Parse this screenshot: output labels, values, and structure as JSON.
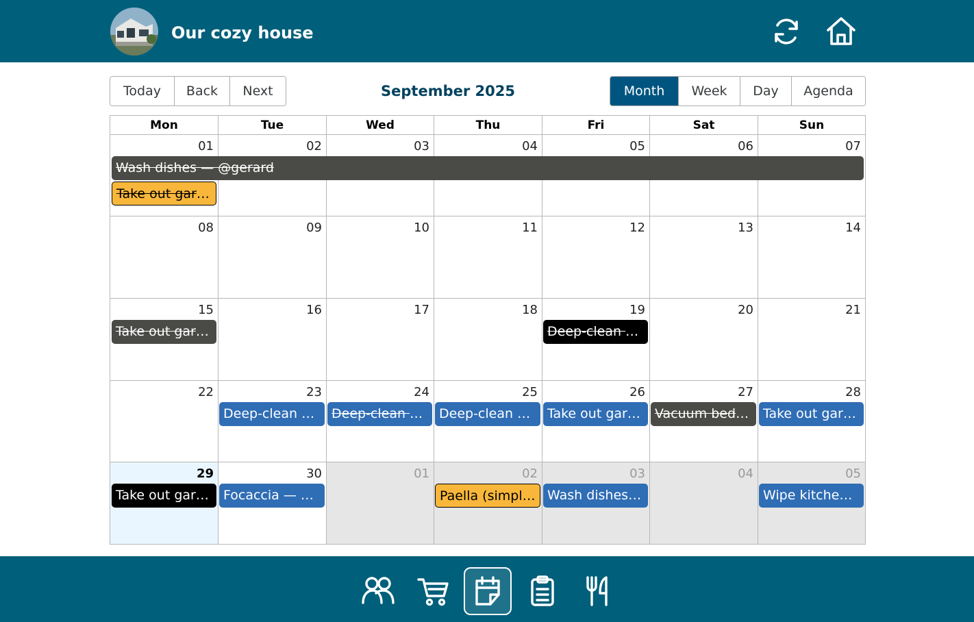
{
  "app": {
    "title": "Our cozy house"
  },
  "toolbar": {
    "nav": [
      "Today",
      "Back",
      "Next"
    ],
    "label": "September 2025",
    "views": [
      "Month",
      "Week",
      "Day",
      "Agenda"
    ],
    "active_view": "Month"
  },
  "calendar": {
    "weekdays": [
      "Mon",
      "Tue",
      "Wed",
      "Thu",
      "Fri",
      "Sat",
      "Sun"
    ],
    "weeks": [
      [
        {
          "day": "01",
          "in_month": true
        },
        {
          "day": "02",
          "in_month": true
        },
        {
          "day": "03",
          "in_month": true
        },
        {
          "day": "04",
          "in_month": true
        },
        {
          "day": "05",
          "in_month": true
        },
        {
          "day": "06",
          "in_month": true
        },
        {
          "day": "07",
          "in_month": true
        }
      ],
      [
        {
          "day": "08",
          "in_month": true
        },
        {
          "day": "09",
          "in_month": true
        },
        {
          "day": "10",
          "in_month": true
        },
        {
          "day": "11",
          "in_month": true
        },
        {
          "day": "12",
          "in_month": true
        },
        {
          "day": "13",
          "in_month": true
        },
        {
          "day": "14",
          "in_month": true
        }
      ],
      [
        {
          "day": "15",
          "in_month": true
        },
        {
          "day": "16",
          "in_month": true
        },
        {
          "day": "17",
          "in_month": true
        },
        {
          "day": "18",
          "in_month": true
        },
        {
          "day": "19",
          "in_month": true
        },
        {
          "day": "20",
          "in_month": true
        },
        {
          "day": "21",
          "in_month": true
        }
      ],
      [
        {
          "day": "22",
          "in_month": true
        },
        {
          "day": "23",
          "in_month": true
        },
        {
          "day": "24",
          "in_month": true
        },
        {
          "day": "25",
          "in_month": true
        },
        {
          "day": "26",
          "in_month": true
        },
        {
          "day": "27",
          "in_month": true
        },
        {
          "day": "28",
          "in_month": true
        }
      ],
      [
        {
          "day": "29",
          "in_month": true,
          "today": true
        },
        {
          "day": "30",
          "in_month": true
        },
        {
          "day": "01",
          "in_month": false
        },
        {
          "day": "02",
          "in_month": false
        },
        {
          "day": "03",
          "in_month": false
        },
        {
          "day": "04",
          "in_month": false
        },
        {
          "day": "05",
          "in_month": false
        }
      ]
    ],
    "events": [
      {
        "week": 0,
        "col": 0,
        "span": 7,
        "slot": 0,
        "title": "Wash dishes — @gerard",
        "done": true,
        "bg": "#4a4a47",
        "color": "#ffffff"
      },
      {
        "week": 0,
        "col": 0,
        "span": 1,
        "slot": 1,
        "title": "Take out garb...",
        "done": true,
        "bg": "#f8b73b",
        "color": "#000000",
        "border": "#000000"
      },
      {
        "week": 2,
        "col": 0,
        "span": 1,
        "slot": 0,
        "title": "Take out garb...",
        "done": true,
        "bg": "#4a4a47",
        "color": "#ffffff"
      },
      {
        "week": 2,
        "col": 4,
        "span": 1,
        "slot": 0,
        "title": "Deep-clean b...",
        "done": true,
        "bg": "#000000",
        "color": "#ffffff"
      },
      {
        "week": 3,
        "col": 1,
        "span": 1,
        "slot": 0,
        "title": "Deep-clean b...",
        "done": false,
        "bg": "#2f6db5",
        "color": "#ffffff"
      },
      {
        "week": 3,
        "col": 2,
        "span": 1,
        "slot": 0,
        "title": "Deep-clean b...",
        "done": true,
        "bg": "#2f6db5",
        "color": "#ffffff"
      },
      {
        "week": 3,
        "col": 3,
        "span": 1,
        "slot": 0,
        "title": "Deep-clean b...",
        "done": false,
        "bg": "#2f6db5",
        "color": "#ffffff"
      },
      {
        "week": 3,
        "col": 4,
        "span": 1,
        "slot": 0,
        "title": "Take out garb...",
        "done": false,
        "bg": "#2f6db5",
        "color": "#ffffff"
      },
      {
        "week": 3,
        "col": 5,
        "span": 1,
        "slot": 0,
        "title": "Vacuum bedr...",
        "done": true,
        "bg": "#4a4a47",
        "color": "#ffffff"
      },
      {
        "week": 3,
        "col": 6,
        "span": 1,
        "slot": 0,
        "title": "Take out garb...",
        "done": false,
        "bg": "#2f6db5",
        "color": "#ffffff"
      },
      {
        "week": 4,
        "col": 0,
        "span": 1,
        "slot": 0,
        "title": "Take out garb...",
        "done": false,
        "bg": "#000000",
        "color": "#ffffff"
      },
      {
        "week": 4,
        "col": 1,
        "span": 1,
        "slot": 0,
        "title": "Focaccia — @...",
        "done": false,
        "bg": "#2f6db5",
        "color": "#ffffff"
      },
      {
        "week": 4,
        "col": 3,
        "span": 1,
        "slot": 0,
        "title": "Paella (simple...",
        "done": false,
        "bg": "#f8b73b",
        "color": "#000000",
        "border": "#000000"
      },
      {
        "week": 4,
        "col": 4,
        "span": 1,
        "slot": 0,
        "title": "Wash dishes ...",
        "done": false,
        "bg": "#2f6db5",
        "color": "#ffffff"
      },
      {
        "week": 4,
        "col": 6,
        "span": 1,
        "slot": 0,
        "title": "Wipe kitchen ...",
        "done": false,
        "bg": "#2f6db5",
        "color": "#ffffff"
      }
    ]
  },
  "header_actions": [
    {
      "icon": "refresh-icon"
    },
    {
      "icon": "home-icon"
    }
  ],
  "bottom_nav": [
    {
      "icon": "people-icon",
      "active": false
    },
    {
      "icon": "cart-icon",
      "active": false
    },
    {
      "icon": "calendar-icon",
      "active": true
    },
    {
      "icon": "clipboard-icon",
      "active": false
    },
    {
      "icon": "utensils-icon",
      "active": false
    }
  ],
  "colors": {
    "header_bg": "#005f7a",
    "active_view_bg": "#005580",
    "event_blue": "#2f6db5",
    "event_gray": "#4a4a47",
    "event_yellow": "#f8b73b",
    "today_bg": "#eaf6ff",
    "off_range_bg": "#e6e6e6"
  }
}
